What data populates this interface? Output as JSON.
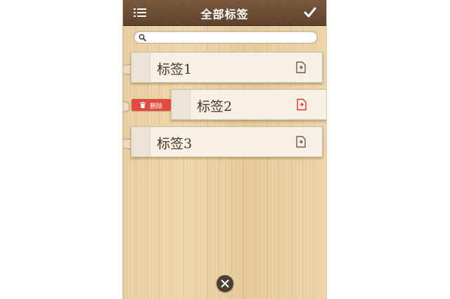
{
  "header": {
    "title": "全部标签",
    "menu_icon": "list-icon",
    "confirm_icon": "check-icon"
  },
  "search": {
    "placeholder": "",
    "icon": "search-icon"
  },
  "tags": [
    {
      "label": "标签1",
      "icon": "edit-icon",
      "highlighted": false
    },
    {
      "label": "标签2",
      "icon": "edit-icon",
      "highlighted": true
    },
    {
      "label": "标签3",
      "icon": "edit-icon",
      "highlighted": false
    }
  ],
  "swipe_action": {
    "label": "删除",
    "icon": "trash-icon",
    "color": "#e04a3f"
  },
  "footer": {
    "close_icon": "close-icon"
  },
  "colors": {
    "navbar": "#5a3e28",
    "highlight": "#e0352b",
    "card": "#f6f0e6"
  }
}
